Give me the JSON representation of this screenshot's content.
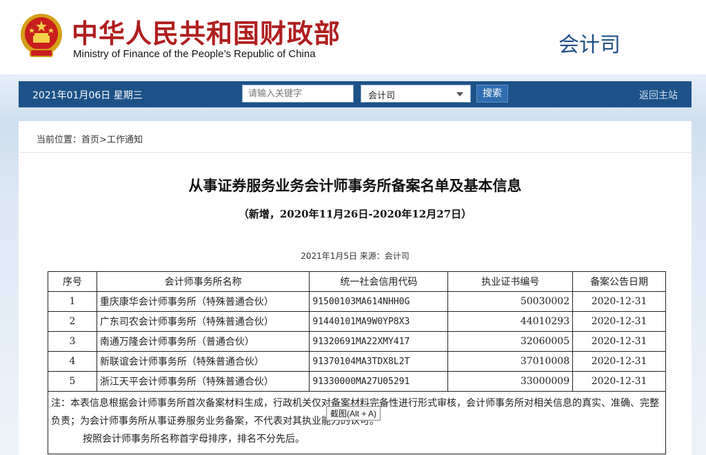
{
  "header": {
    "title_cn": "中华人民共和国财政部",
    "title_en": "Ministry of Finance of the People’s Republic of China",
    "dept": "会计司",
    "emblem_icon": "national-emblem",
    "title_color": "#b01e1e",
    "dept_color": "#1e4f86"
  },
  "navbar": {
    "date": "2021年01月06日  星期三",
    "search_placeholder": "请输入关键字",
    "select_value": "会计司",
    "search_button": "搜索",
    "home_link": "返回主站",
    "bg_color": "#1d5289"
  },
  "breadcrumb": {
    "prefix": "当前位置：",
    "home": "首页",
    "sep": ">",
    "current": "工作通知"
  },
  "document": {
    "title": "从事证券服务业务会计师事务所备案名单及基本信息",
    "subtitle": "（新增，2020年11月26日-2020年12月27日）",
    "meta": "2021年1月5日  来源：会计司"
  },
  "table": {
    "headers": [
      "序号",
      "会计师事务所名称",
      "统一社会信用代码",
      "执业证书编号",
      "备案公告日期"
    ],
    "rows": [
      {
        "num": "1",
        "name": "重庆康华会计师事务所（特殊普通合伙）",
        "code": "91500103MA614NHH0G",
        "cert": "50030002",
        "date": "2020-12-31"
      },
      {
        "num": "2",
        "name": "广东司农会计师事务所（特殊普通合伙）",
        "code": "91440101MA9W0YP8X3",
        "cert": "44010293",
        "date": "2020-12-31"
      },
      {
        "num": "3",
        "name": "南通万隆会计师事务所（普通合伙）",
        "code": "91320691MA22XMY417",
        "cert": "32060005",
        "date": "2020-12-31"
      },
      {
        "num": "4",
        "name": "新联谊会计师事务所（特殊普通合伙）",
        "code": "91370104MA3TDX8L2T",
        "cert": "37010008",
        "date": "2020-12-31"
      },
      {
        "num": "5",
        "name": "浙江天平会计师事务所（特殊普通合伙）",
        "code": "91330000MA27U05291",
        "cert": "33000009",
        "date": "2020-12-31"
      }
    ],
    "note1": "注：本表信息根据会计师事务所首次备案材料生成，行政机关仅对备案材料完备性进行形式审核，会计师事务所对相关信息的真实、准确、完整负责；为会计师事务所从事证券服务业务备案，不代表对其执业能力的认可。",
    "note2": "按照会计师事务所名称首字母排序，排名不分先后。"
  },
  "tooltip": "截图(Alt + A)"
}
